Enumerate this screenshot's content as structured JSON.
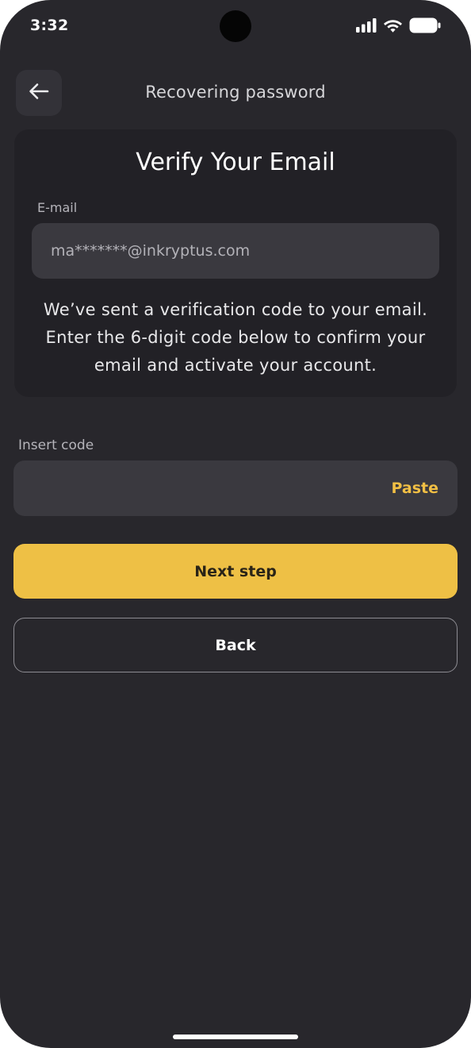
{
  "status_bar": {
    "time": "3:32",
    "icons": [
      "cellular-signal-icon",
      "wifi-icon",
      "battery-icon"
    ]
  },
  "header": {
    "back_icon": "arrow-left-icon",
    "title": "Recovering password"
  },
  "verify_card": {
    "title": "Verify Your Email",
    "email_label": "E-mail",
    "email_value": "ma*******@inkryptus.com",
    "description": "We’ve sent a verification code to your email. Enter the 6-digit code below to confirm your email and activate your account."
  },
  "code": {
    "label": "Insert code",
    "value": "",
    "paste_label": "Paste"
  },
  "actions": {
    "next_label": "Next step",
    "back_label": "Back"
  },
  "colors": {
    "background": "#28272c",
    "card": "#222126",
    "field": "#3a393f",
    "accent": "#eec045",
    "paste": "#f1bf44"
  }
}
